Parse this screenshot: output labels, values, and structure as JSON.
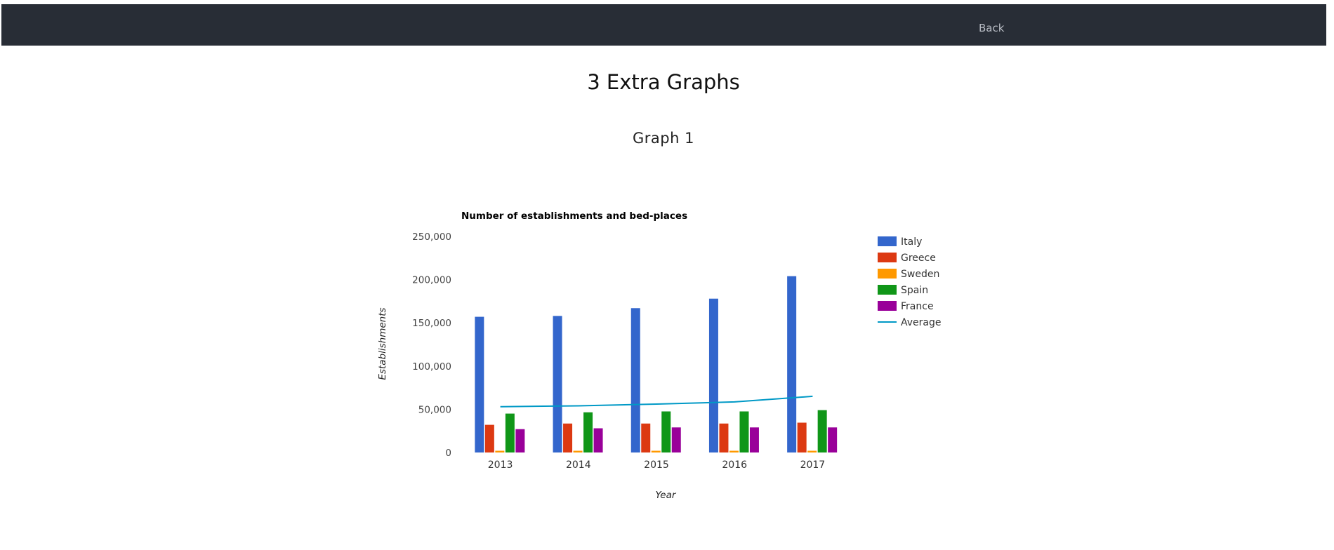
{
  "navbar": {
    "back_label": "Back"
  },
  "page": {
    "title": "3 Extra Graphs",
    "section_title": "Graph 1"
  },
  "colors": {
    "navbar_bg": "#282d36",
    "Italy": "#3366cc",
    "Greece": "#dc3912",
    "Sweden": "#ff9900",
    "Spain": "#109618",
    "France": "#990099",
    "Average": "#0099c6"
  },
  "chart_data": {
    "type": "bar",
    "title": "Number of establishments and bed-places",
    "xlabel": "Year",
    "ylabel": "Establishments",
    "categories": [
      "2013",
      "2014",
      "2015",
      "2016",
      "2017"
    ],
    "ylim": [
      0,
      250000
    ],
    "yticks": [
      "0",
      "50,000",
      "100,000",
      "150,000",
      "200,000",
      "250,000"
    ],
    "ytick_values": [
      0,
      50000,
      100000,
      150000,
      200000,
      250000
    ],
    "series": [
      {
        "name": "Italy",
        "values": [
          157000,
          158000,
          167000,
          178000,
          204000
        ]
      },
      {
        "name": "Greece",
        "values": [
          32000,
          33500,
          33500,
          33500,
          34500
        ]
      },
      {
        "name": "Sweden",
        "values": [
          2000,
          2000,
          2000,
          2000,
          2000
        ]
      },
      {
        "name": "Spain",
        "values": [
          45000,
          46500,
          47500,
          47500,
          49000
        ]
      },
      {
        "name": "France",
        "values": [
          27000,
          28000,
          29000,
          29000,
          29000
        ]
      }
    ],
    "line_series": {
      "name": "Average",
      "values": [
        53000,
        54000,
        56000,
        58500,
        65000
      ]
    },
    "legend_position": "right"
  }
}
